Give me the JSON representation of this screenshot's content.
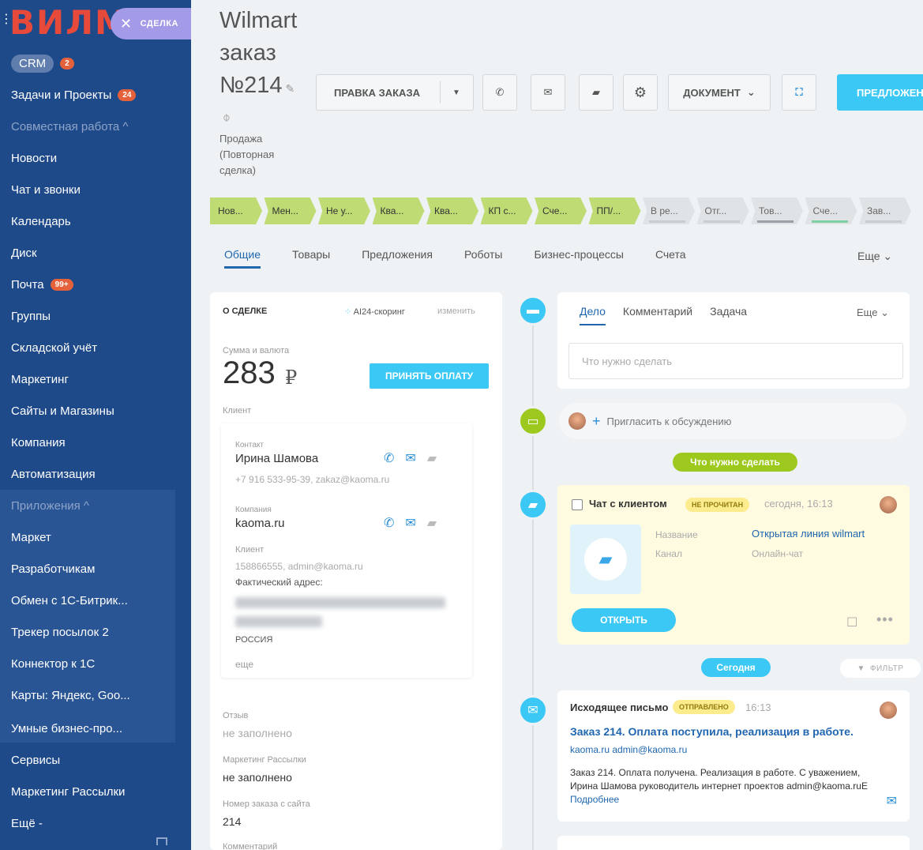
{
  "sidebar": {
    "logo": "ВИЛМ",
    "close_label": "СДЕЛКА",
    "crm": {
      "label": "CRM",
      "badge": "2"
    },
    "items": [
      {
        "label": "Задачи и Проекты",
        "badge": "24"
      },
      {
        "label": "Совместная работа ^"
      },
      {
        "label": "Новости"
      },
      {
        "label": "Чат и звонки"
      },
      {
        "label": "Календарь"
      },
      {
        "label": "Диск"
      },
      {
        "label": "Почта",
        "badge": "99+"
      },
      {
        "label": "Группы"
      },
      {
        "label": "Складской учёт"
      },
      {
        "label": "Маркетинг"
      },
      {
        "label": "Сайты и Магазины"
      },
      {
        "label": "Компания"
      },
      {
        "label": "Автоматизация"
      },
      {
        "label": "Приложения ^"
      },
      {
        "label": "Маркет"
      },
      {
        "label": "Разработчикам"
      },
      {
        "label": "Обмен с 1С-Битрик..."
      },
      {
        "label": "Трекер посылок 2"
      },
      {
        "label": "Коннектор к 1С"
      },
      {
        "label": "Карты: Яндекс, Goo..."
      },
      {
        "label": "Умные бизнес-про..."
      },
      {
        "label": "Сервисы"
      },
      {
        "label": "Маркетинг Рассылки"
      },
      {
        "label": "Ещё -"
      }
    ]
  },
  "header": {
    "title_line1": "Wilmart",
    "title_line2": "заказ",
    "title_line3": "№214",
    "deal_type": "Продажа (Повторная сделка)"
  },
  "toolbar": {
    "edit_order": "ПРАВКА ЗАКАЗА",
    "document": "ДОКУМЕНТ",
    "offer": "ПРЕДЛОЖЕН"
  },
  "stages": [
    {
      "label": "Нов...",
      "state": "done"
    },
    {
      "label": "Мен...",
      "state": "done"
    },
    {
      "label": "Не у...",
      "state": "done"
    },
    {
      "label": "Ква...",
      "state": "done"
    },
    {
      "label": "Ква...",
      "state": "done"
    },
    {
      "label": "КП с...",
      "state": "done"
    },
    {
      "label": "Сче...",
      "state": "done"
    },
    {
      "label": "ПП/...",
      "state": "done"
    },
    {
      "label": "В ре...",
      "state": "todo",
      "line": "#c9cdd2"
    },
    {
      "label": "Отг...",
      "state": "todo",
      "line": "#c9cdd2"
    },
    {
      "label": "Тов...",
      "state": "todo",
      "line": "#9aa0a6"
    },
    {
      "label": "Сче...",
      "state": "todo",
      "line": "#7fd1a4"
    },
    {
      "label": "Зав...",
      "state": "todo",
      "line": "#c9cdd2"
    }
  ],
  "tabs": [
    "Общие",
    "Товары",
    "Предложения",
    "Роботы",
    "Бизнес-процессы",
    "Счета"
  ],
  "tabs_more": "Еще",
  "deal": {
    "section_title": "О СДЕЛКЕ",
    "ai_scoring": "AI24-скоринг",
    "change": "изменить",
    "amount_label": "Сумма и валюта",
    "amount": "283",
    "currency": "₽",
    "pay_button": "ПРИНЯТЬ ОПЛАТУ",
    "client_label": "Клиент",
    "contact_label": "Контакт",
    "contact_name": "Ирина Шамова",
    "contact_meta": "+7 916 533-95-39, zakaz@kaoma.ru",
    "company_label": "Компания",
    "company_name": "kaoma.ru",
    "client_sub_label": "Клиент",
    "client_meta": "158866555, admin@kaoma.ru",
    "address_label": "Фактический адрес:",
    "country": "РОССИЯ",
    "more": "еще",
    "review_label": "Отзыв",
    "review_value": "не заполнено",
    "mailing_label": "Маркетинг Рассылки",
    "mailing_value": "не заполнено",
    "order_no_label": "Номер заказа с сайта",
    "order_no_value": "214",
    "comment_label": "Комментарий"
  },
  "activity": {
    "tabs": [
      "Дело",
      "Комментарий",
      "Задача"
    ],
    "more": "Еще",
    "todo_placeholder": "Что нужно сделать",
    "invite": "Пригласить к обсуждению",
    "todo_pill": "Что нужно сделать",
    "chat": {
      "title": "Чат с клиентом",
      "tag": "НЕ ПРОЧИТАН",
      "time": "сегодня, 16:13",
      "name_key": "Название",
      "name_value": "Открытая линия wilmart",
      "channel_key": "Канал",
      "channel_value": "Онлайн-чат",
      "open_button": "ОТКРЫТЬ"
    },
    "today_pill": "Сегодня",
    "filter": "ФИЛЬТР",
    "mail": {
      "title": "Исходящее письмо",
      "tag": "ОТПРАВЛЕНО",
      "time": "16:13",
      "subject": "Заказ 214. Оплата поступила, реализация в работе.",
      "from": "kaoma.ru admin@kaoma.ru",
      "body": "Заказ 214. Оплата получена. Реализация в работе. С уважением, Ирина Шамова руководитель интернет проектов admin@kaoma.ruЕ",
      "more_link": "Подробнее"
    }
  },
  "colors": {
    "sidebar": "#1f4a8a",
    "accent": "#3bc8f5",
    "stage_done": "#bfdb74",
    "link": "#2067b0"
  }
}
